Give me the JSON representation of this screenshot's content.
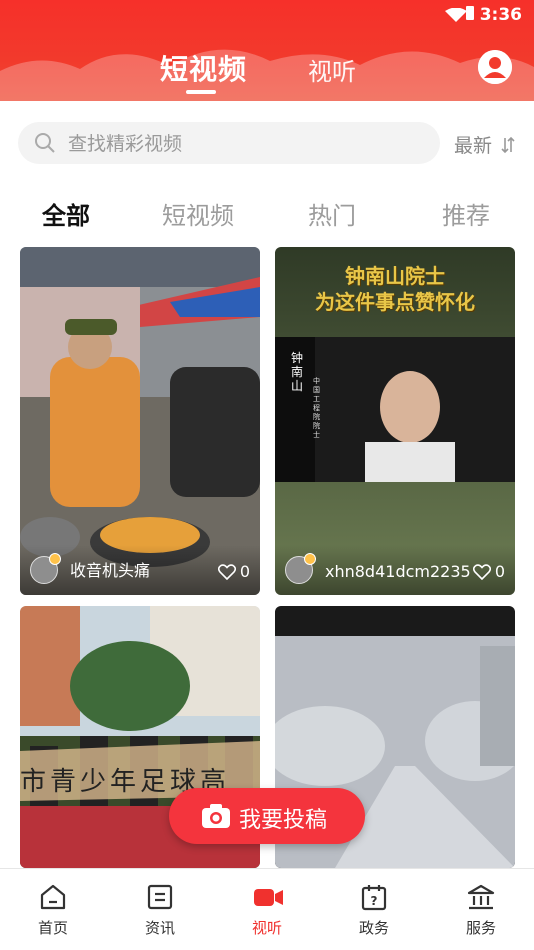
{
  "status_bar": {
    "time": "3:36"
  },
  "header": {
    "tabs": [
      {
        "label": "短视频",
        "active": true
      },
      {
        "label": "视听",
        "active": false
      }
    ],
    "user_icon": "user-circle-icon"
  },
  "search": {
    "placeholder": "查找精彩视频",
    "value": "",
    "sort_label": "最新"
  },
  "categories": [
    {
      "label": "全部",
      "active": true
    },
    {
      "label": "短视频",
      "active": false
    },
    {
      "label": "热门",
      "active": false
    },
    {
      "label": "推荐",
      "active": false
    }
  ],
  "videos": [
    {
      "author": "收音机头痛",
      "likes": "0",
      "overlay_title": ""
    },
    {
      "author": "xhn8d41dcm2235",
      "likes": "0",
      "overlay_title": "钟南山院士\n为这件事点赞怀化",
      "overlay_side": "钟南山",
      "overlay_side2": "中国工程院院士"
    },
    {
      "author": "",
      "likes": "",
      "overlay_title": "市青少年足球高"
    },
    {
      "author": "",
      "likes": "",
      "overlay_title": ""
    }
  ],
  "fab": {
    "label": "我要投稿"
  },
  "bottom_nav": [
    {
      "label": "首页",
      "icon": "home-icon",
      "active": false
    },
    {
      "label": "资讯",
      "icon": "news-icon",
      "active": false
    },
    {
      "label": "视听",
      "icon": "video-camera-icon",
      "active": true
    },
    {
      "label": "政务",
      "icon": "question-calendar-icon",
      "active": false
    },
    {
      "label": "服务",
      "icon": "building-icon",
      "active": false
    }
  ],
  "colors": {
    "brand": "#f23a2c",
    "fab": "#f4343d",
    "active_nav": "#f0312e"
  }
}
